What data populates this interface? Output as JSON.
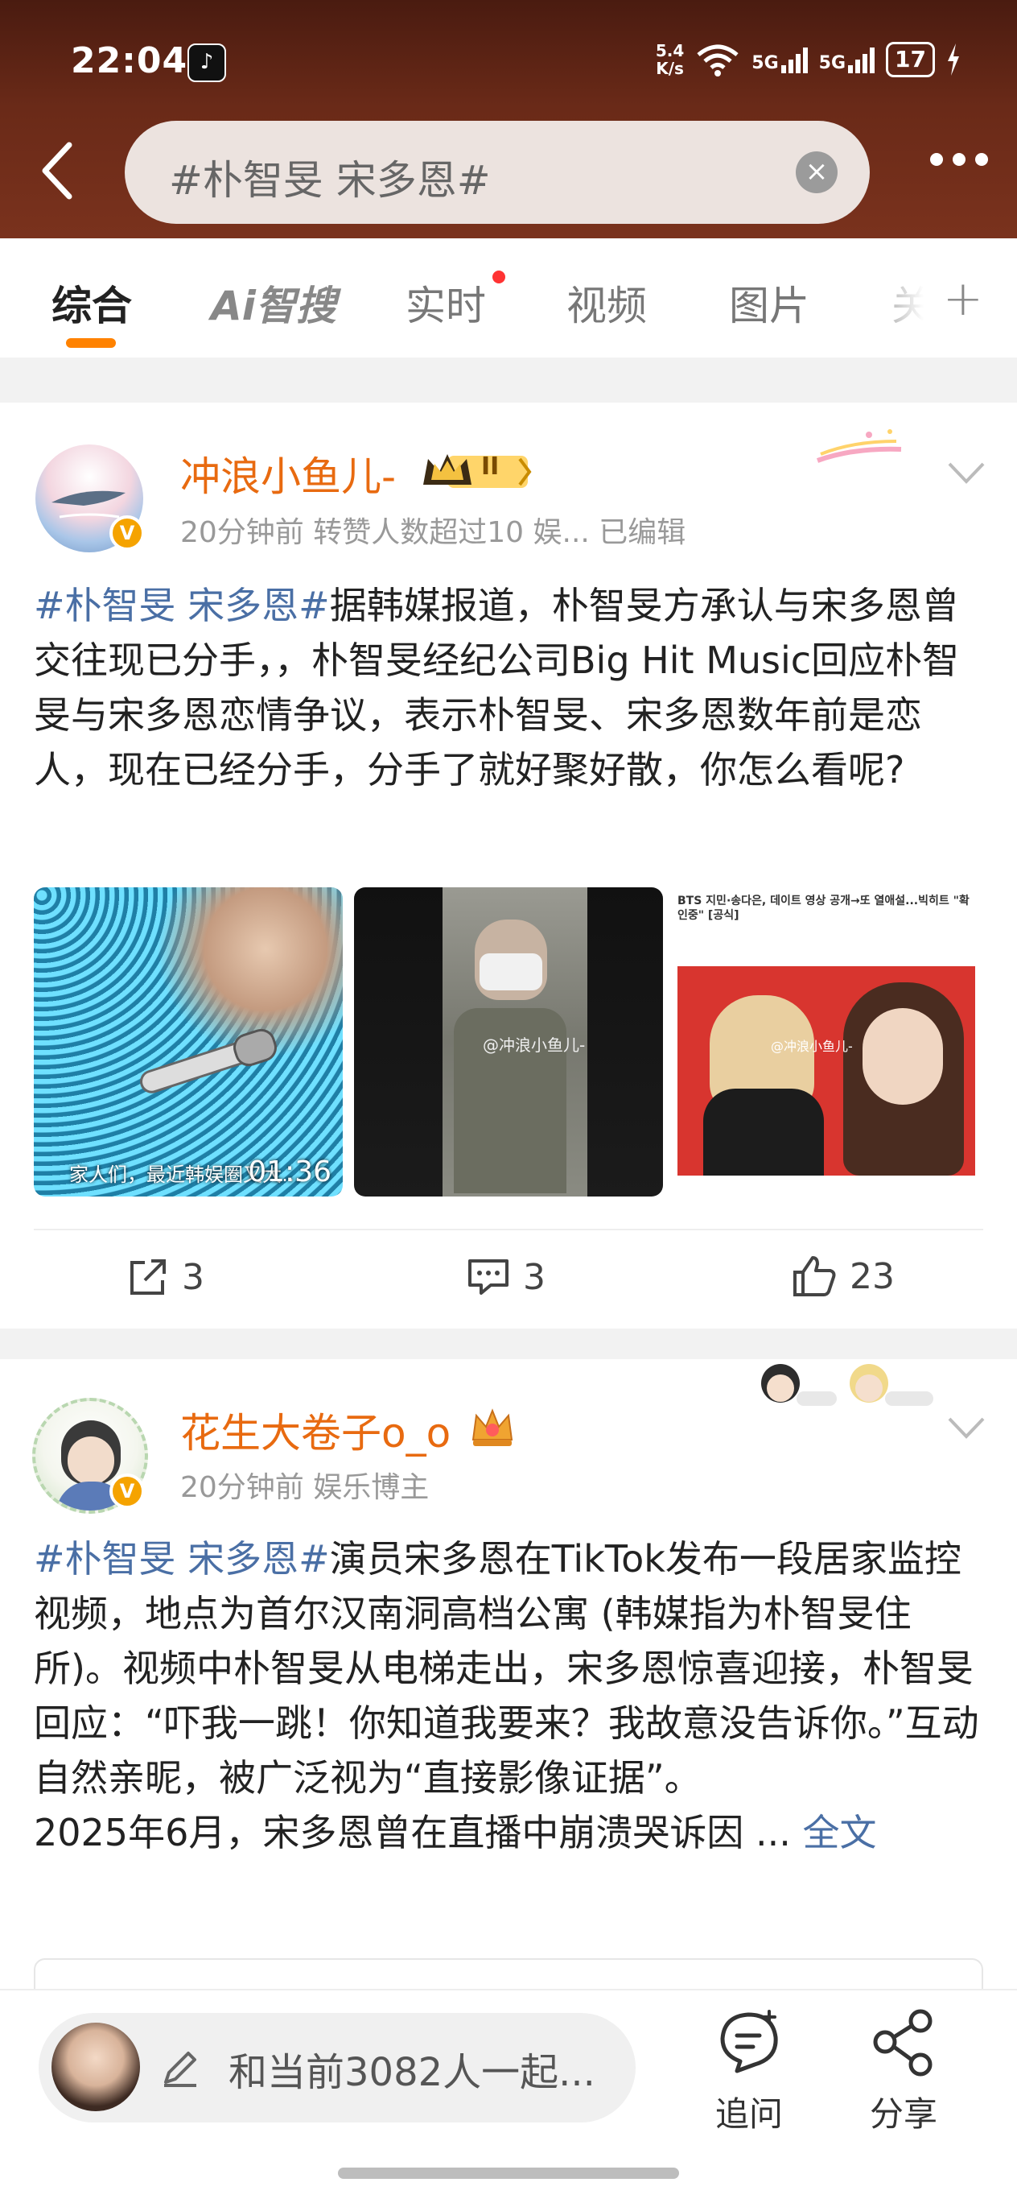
{
  "status_bar": {
    "time": "22:04",
    "net_speed_value": "5.4",
    "net_speed_unit": "K/s",
    "signal1": "5G",
    "signal2": "5G",
    "battery": "17"
  },
  "search": {
    "query": "#朴智旻 宋多恩#"
  },
  "tabs": [
    "综合",
    "Ai智搜",
    "实时",
    "视频",
    "图片",
    "关"
  ],
  "posts": [
    {
      "username": "冲浪小鱼儿-",
      "level_badge": "II",
      "meta": "20分钟前  转赞人数超过10   娱...   已编辑",
      "hashtag": "#朴智旻 宋多恩#",
      "text": "据韩媒报道，朴智旻方承认与宋多恩曾交往现已分手，，朴智旻经纪公司Big Hit Music回应朴智旻与宋多恩恋情争议，表示朴智旻、宋多恩数年前是恋人，现在已经分手，分手了就好聚好散，你怎么看呢?",
      "images": {
        "img1_caption": "家人们，最近韩娱圈又大…",
        "img1_duration": "01:36",
        "img2_watermark": "@冲浪小鱼儿-",
        "img3_headline": "BTS 지민·송다은, 데이트 영상 공개→또 열애설...빅히트 \"확인중\" [공식]",
        "img3_watermark": "@冲浪小鱼儿-"
      },
      "reposts": "3",
      "comments": "3",
      "likes": "23"
    },
    {
      "username": "花生大卷子o_o",
      "meta": "20分钟前   娱乐博主",
      "hashtag": "#朴智旻 宋多恩#",
      "text": "演员宋多恩在TikTok发布一段居家监控视频，地点为首尔汉南洞高档公寓 (韩媒指为朴智旻住所)。视频中朴智旻从电梯走出，宋多恩惊喜迎接，朴智旻回应：“吓我一跳！你知道我要来？我故意没告诉你。”互动自然亲昵，被广泛视为“直接影像证据”。",
      "text2": "2025年6月，宋多恩曾在直播中崩溃哭诉因 ...",
      "full_text": "全文"
    }
  ],
  "bottom_bar": {
    "comment_placeholder": "和当前3082人一起...",
    "ask_label": "追问",
    "share_label": "分享"
  },
  "colors": {
    "accent_orange": "#ff8200",
    "username_orange": "#e86a10",
    "hashtag_blue": "#4a6fa5",
    "header_brown": "#6a2a18"
  }
}
